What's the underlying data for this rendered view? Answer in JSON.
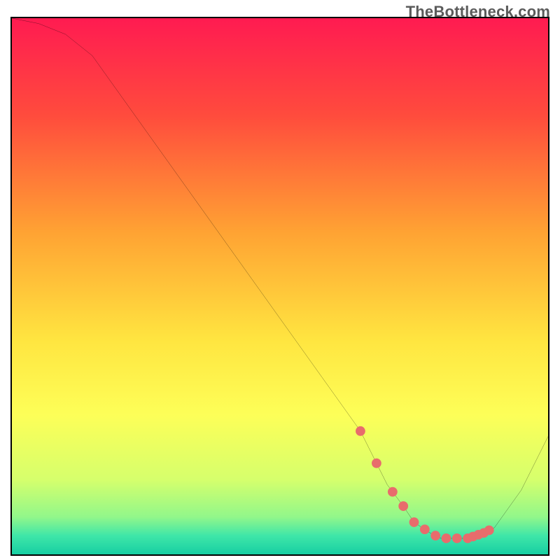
{
  "attribution": "TheBottleneck.com",
  "chart_data": {
    "type": "line",
    "title": "",
    "xlabel": "",
    "ylabel": "",
    "xlim": [
      0,
      100
    ],
    "ylim": [
      0,
      100
    ],
    "x": [
      0,
      5,
      10,
      15,
      20,
      25,
      30,
      35,
      40,
      45,
      50,
      55,
      60,
      65,
      68,
      70,
      73,
      75,
      78,
      80,
      83,
      85,
      88,
      90,
      95,
      100
    ],
    "y": [
      100,
      99,
      97,
      93,
      86,
      79,
      72,
      65,
      58,
      51,
      44,
      37,
      30,
      23,
      17,
      13,
      9,
      6,
      4,
      3,
      3,
      3,
      4,
      5,
      12,
      22
    ],
    "gradient_stops": [
      {
        "offset": 0.0,
        "color": "#ff1b51"
      },
      {
        "offset": 0.18,
        "color": "#ff4b3d"
      },
      {
        "offset": 0.4,
        "color": "#ffa333"
      },
      {
        "offset": 0.6,
        "color": "#ffe540"
      },
      {
        "offset": 0.74,
        "color": "#fdff58"
      },
      {
        "offset": 0.86,
        "color": "#d6ff6c"
      },
      {
        "offset": 0.93,
        "color": "#92f78a"
      },
      {
        "offset": 0.965,
        "color": "#3fe6a8"
      },
      {
        "offset": 1.0,
        "color": "#17cfa3"
      }
    ],
    "markers": {
      "color": "#e86c6c",
      "radius_units": 0.9,
      "points_x": [
        65,
        68,
        71,
        73,
        75,
        77,
        79,
        81,
        83,
        85,
        86,
        87,
        88,
        89
      ]
    }
  }
}
